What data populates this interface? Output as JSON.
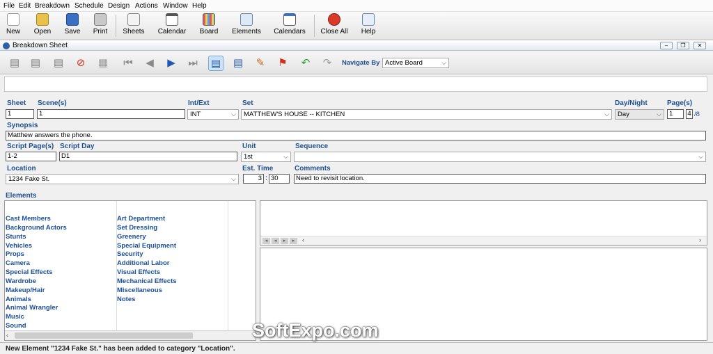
{
  "menu": [
    "File",
    "Edit",
    "Breakdown",
    "Schedule",
    "Design",
    "Actions",
    "Window",
    "Help"
  ],
  "toolbar": {
    "new": "New",
    "open": "Open",
    "save": "Save",
    "print": "Print",
    "sheets": "Sheets",
    "calendar": "Calendar",
    "board": "Board",
    "elements": "Elements",
    "calendars": "Calendars",
    "close_all": "Close All",
    "help": "Help"
  },
  "window": {
    "title": "Breakdown Sheet"
  },
  "navigate": {
    "label": "Navigate By :",
    "value": "Active Board"
  },
  "form": {
    "sheet_label": "Sheet",
    "sheet_value": "1",
    "scenes_label": "Scene(s)",
    "scenes_value": "1",
    "intext_label": "Int/Ext",
    "intext_value": "INT",
    "set_label": "Set",
    "set_value": "MATTHEW'S HOUSE -- KITCHEN",
    "daynight_label": "Day/Night",
    "daynight_value": "Day",
    "pages_label": "Page(s)",
    "pages_whole": "1",
    "pages_num": "4",
    "pages_den": "/8",
    "synopsis_label": "Synopsis",
    "synopsis_value": "Matthew answers the phone.",
    "script_page_label": "Script Page(s)",
    "script_page_value": "1-2",
    "script_day_label": "Script Day",
    "script_day_value": "D1",
    "unit_label": "Unit",
    "unit_value": "1st",
    "sequence_label": "Sequence",
    "sequence_value": "",
    "location_label": "Location",
    "location_value": "1234 Fake St.",
    "est_time_label": "Est. Time",
    "est_time_hours": "3",
    "est_time_sep": ":",
    "est_time_minutes": "30",
    "comments_label": "Comments",
    "comments_value": "Need to revisit location."
  },
  "elements": {
    "label": "Elements",
    "left_categories": [
      "Cast Members",
      "Background Actors",
      "Stunts",
      "Vehicles",
      "Props",
      "Camera",
      "Special Effects",
      "Wardrobe",
      "Makeup/Hair",
      "Animals",
      "Animal Wrangler",
      "Music",
      "Sound"
    ],
    "right_categories": [
      "Art Department",
      "Set Dressing",
      "Greenery",
      "Special Equipment",
      "Security",
      "Additional Labor",
      "Visual Effects",
      "Mechanical Effects",
      "Miscellaneous",
      "Notes"
    ]
  },
  "status": {
    "message": "New Element \"1234 Fake St.\" has been added to category \"Location\"."
  },
  "watermark": "SoftExpo.com"
}
